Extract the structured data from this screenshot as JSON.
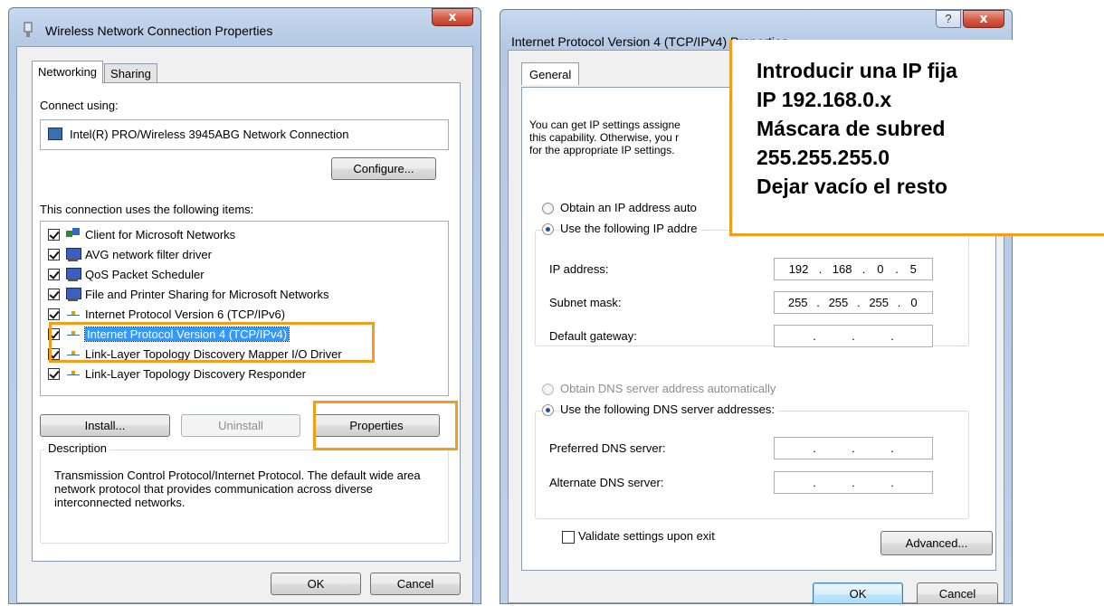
{
  "left_dialog": {
    "title": "Wireless Network Connection Properties",
    "close_glyph": "x",
    "tabs": [
      "Networking",
      "Sharing"
    ],
    "connect_using_label": "Connect using:",
    "adapter_name": "Intel(R) PRO/Wireless 3945ABG Network Connection",
    "configure_label": "Configure...",
    "items_label": "This connection uses the following items:",
    "items": [
      {
        "label": "Client for Microsoft Networks",
        "checked": true,
        "icon": "client-icon"
      },
      {
        "label": "AVG network filter driver",
        "checked": true,
        "icon": "computer-icon"
      },
      {
        "label": "QoS Packet Scheduler",
        "checked": true,
        "icon": "computer-icon"
      },
      {
        "label": "File and Printer Sharing for Microsoft Networks",
        "checked": true,
        "icon": "computer-icon"
      },
      {
        "label": "Internet Protocol Version 6 (TCP/IPv6)",
        "checked": true,
        "icon": "network-protocol-icon"
      },
      {
        "label": "Internet Protocol Version 4 (TCP/IPv4)",
        "checked": true,
        "icon": "network-protocol-icon",
        "selected": true
      },
      {
        "label": "Link-Layer Topology Discovery Mapper I/O Driver",
        "checked": true,
        "icon": "network-protocol-icon"
      },
      {
        "label": "Link-Layer Topology Discovery Responder",
        "checked": true,
        "icon": "network-protocol-icon"
      }
    ],
    "install_label": "Install...",
    "uninstall_label": "Uninstall",
    "properties_label": "Properties",
    "description_label": "Description",
    "description_text": "Transmission Control Protocol/Internet Protocol. The default wide area network protocol that provides communication across diverse interconnected networks.",
    "ok_label": "OK",
    "cancel_label": "Cancel"
  },
  "right_dialog": {
    "title": "Internet Protocol Version 4 (TCP/IPv4) Properties",
    "help_glyph": "?",
    "close_glyph": "x",
    "tab": "General",
    "intro_lines": [
      "You can get IP settings assigne",
      "this capability. Otherwise, you r",
      "for the appropriate IP settings."
    ],
    "obtain_ip_auto_label": "Obtain an IP address auto",
    "use_ip_label": "Use the following IP addre",
    "ip_address_label": "IP address:",
    "ip_address_value": [
      "192",
      "168",
      "0",
      "5"
    ],
    "subnet_mask_label": "Subnet mask:",
    "subnet_mask_value": [
      "255",
      "255",
      "255",
      "0"
    ],
    "default_gateway_label": "Default gateway:",
    "obtain_dns_auto_label": "Obtain DNS server address automatically",
    "use_dns_label": "Use the following DNS server addresses:",
    "preferred_dns_label": "Preferred DNS server:",
    "alternate_dns_label": "Alternate DNS server:",
    "validate_label": "Validate settings upon exit",
    "advanced_label": "Advanced...",
    "ok_label": "OK",
    "cancel_label": "Cancel"
  },
  "annotation": {
    "lines": [
      "Introducir una IP fija",
      "IP 192.168.0.x",
      "Máscara de subred",
      "255.255.255.0",
      "Dejar vacío el resto"
    ],
    "highlight_color": "#f39c1e"
  }
}
